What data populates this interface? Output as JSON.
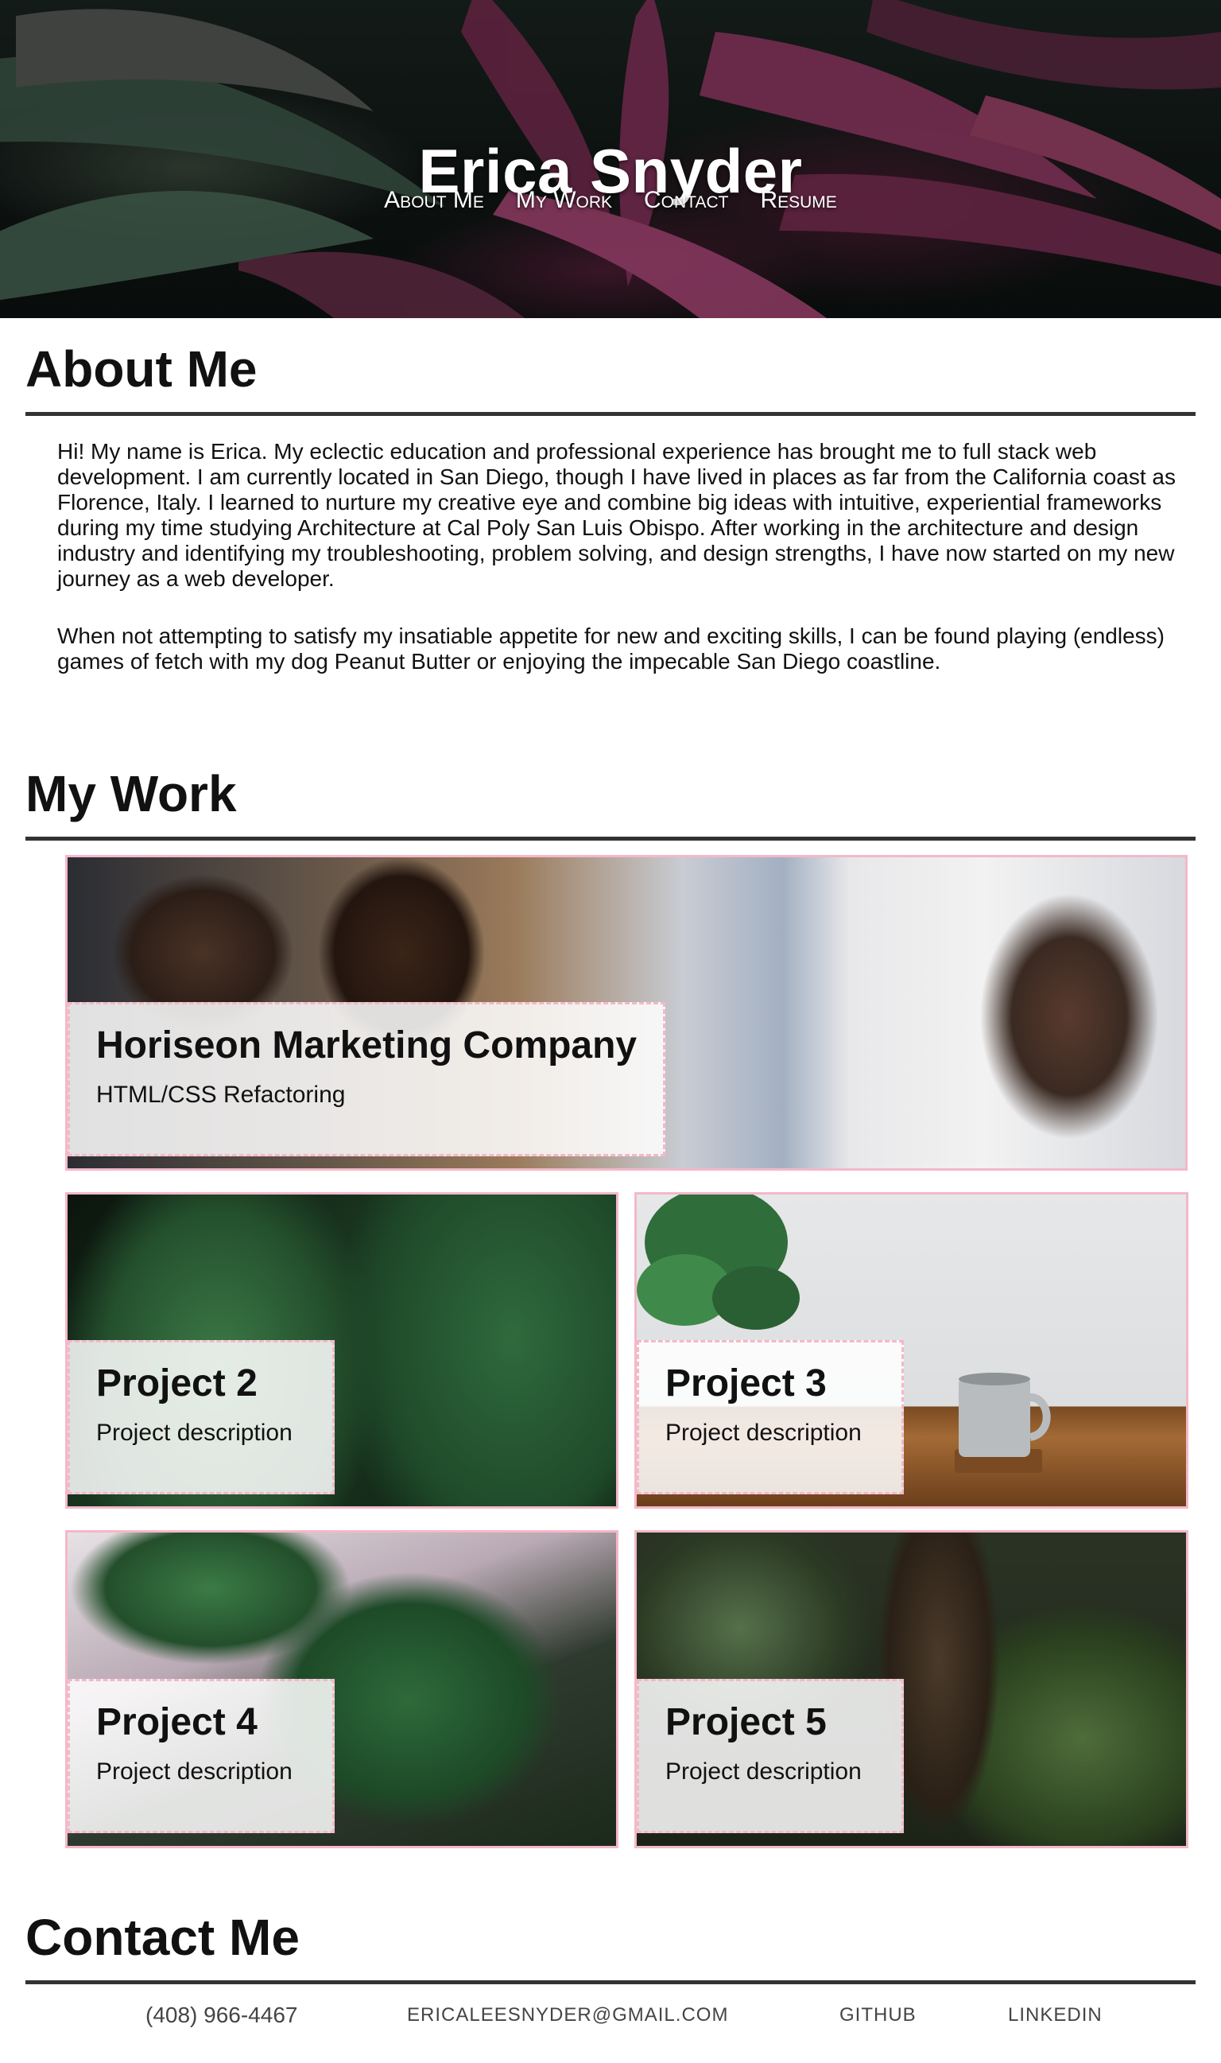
{
  "hero": {
    "title": "Erica Snyder",
    "nav": [
      {
        "label": "About Me"
      },
      {
        "label": "My Work"
      },
      {
        "label": "Contact"
      },
      {
        "label": "Resume"
      }
    ]
  },
  "about": {
    "heading": "About Me",
    "paragraphs": [
      "Hi! My name is Erica. My eclectic education and professional experience has brought me to full stack web development. I am currently located in San Diego, though I have lived in places as far from the California coast as Florence, Italy. I learned to nurture my creative eye and combine big ideas with intuitive, experiential frameworks during my time studying Architecture at Cal Poly San Luis Obispo. After working in the architecture and design industry and identifying my troubleshooting, problem solving, and design strengths, I have now started on my new journey as a web developer.",
      "When not attempting to satisfy my insatiable appetite for new and exciting skills, I can be found playing (endless) games of fetch with my dog Peanut Butter or enjoying the impecable San Diego coastline."
    ]
  },
  "work": {
    "heading": "My Work",
    "projects": [
      {
        "title": "Horiseon Marketing Company",
        "description": "HTML/CSS Refactoring"
      },
      {
        "title": "Project 2",
        "description": "Project description"
      },
      {
        "title": "Project 3",
        "description": "Project description"
      },
      {
        "title": "Project 4",
        "description": "Project description"
      },
      {
        "title": "Project 5",
        "description": "Project description"
      }
    ]
  },
  "contact": {
    "heading": "Contact Me",
    "phone": "(408) 966-4467",
    "email": "ericaleesnyder@gmail.com",
    "github": "Github",
    "linkedin": "LinkedIn"
  },
  "colors": {
    "card_border": "#f4b8c8",
    "heading_rule": "#333333"
  }
}
